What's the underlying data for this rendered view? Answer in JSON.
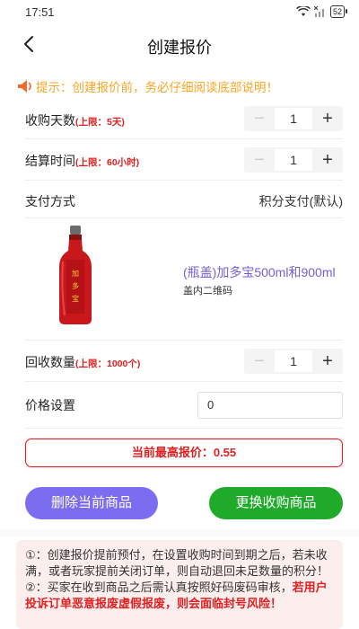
{
  "status": {
    "time": "17:51",
    "battery": "52"
  },
  "nav": {
    "title": "创建报价"
  },
  "notice": {
    "text": "提示：创建报价前，务必仔细阅读底部说明！"
  },
  "form": {
    "days": {
      "label": "收购天数",
      "limit": "(上限：5天)",
      "value": "1"
    },
    "settle": {
      "label": "结算时间",
      "limit": "(上限：60小时)",
      "value": "1"
    },
    "payment": {
      "label": "支付方式",
      "value": "积分支付(默认)"
    },
    "quantity": {
      "label": "回收数量",
      "limit": "(上限：1000个)",
      "value": "1"
    },
    "price": {
      "label": "价格设置",
      "value": "0"
    }
  },
  "product": {
    "name": "(瓶盖)加多宝500ml和900ml",
    "sub": "盖内二维码",
    "brand_text": "加多宝"
  },
  "highest": {
    "text": "当前最高报价：0.55"
  },
  "buttons": {
    "delete": "删除当前商品",
    "change": "更换收购商品"
  },
  "notes": {
    "line1": "①：创建报价提前预付，在设置收购时间到期之后，若未收满，或者玩家提前关闭订单，则自动退回未足数量的积分！",
    "line2_plain": "②：买家在收到商品之后需认真按照好码废码审核，",
    "line2_red": "若用户投诉订单恶意报废虚假报废，则会面临封号风险！"
  },
  "colors": {
    "accent": "#7b6cf0",
    "green": "#1faa2a",
    "red": "#e02020",
    "notice": "#f5a623"
  },
  "icons": {
    "back": "chevron-left-icon",
    "notice": "speaker-icon",
    "minus": "minus-icon",
    "plus": "plus-icon"
  }
}
